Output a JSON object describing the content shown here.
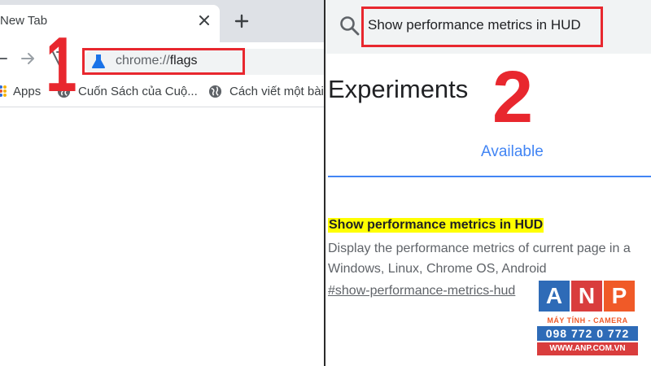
{
  "left": {
    "tab": {
      "title": "New Tab"
    },
    "omnibox": {
      "scheme": "chrome://",
      "path": "flags",
      "icon": "flask-icon"
    },
    "bookmarks": [
      {
        "label": "Apps",
        "icon": "apps-grid-icon"
      },
      {
        "label": "Cuốn Sách của Cuộ...",
        "icon": "globe-icon"
      },
      {
        "label": "Cách viết một bài",
        "icon": "globe-icon"
      }
    ],
    "step_label": "1"
  },
  "right": {
    "search": {
      "value": "Show performance metrics in HUD",
      "icon": "search-icon"
    },
    "page_title": "Experiments",
    "tabs": [
      {
        "label": "Available",
        "active": true
      }
    ],
    "step_label": "2",
    "flag": {
      "title": "Show performance metrics in HUD",
      "description_line1": "Display the performance metrics of current page in a",
      "description_line2": "Windows, Linux, Chrome OS, Android",
      "link": "#show-performance-metrics-hud"
    }
  },
  "watermark": {
    "letters": [
      "A",
      "N",
      "P"
    ],
    "subtitle": "MÁY TÍNH - CAMERA",
    "phone": "098 772 0 772",
    "website": "WWW.ANP.COM.VN"
  },
  "colors": {
    "annotation_red": "#e8272e",
    "link_blue": "#4285f4",
    "highlight_yellow": "#ffff00",
    "tabstrip_gray": "#dee1e6"
  }
}
